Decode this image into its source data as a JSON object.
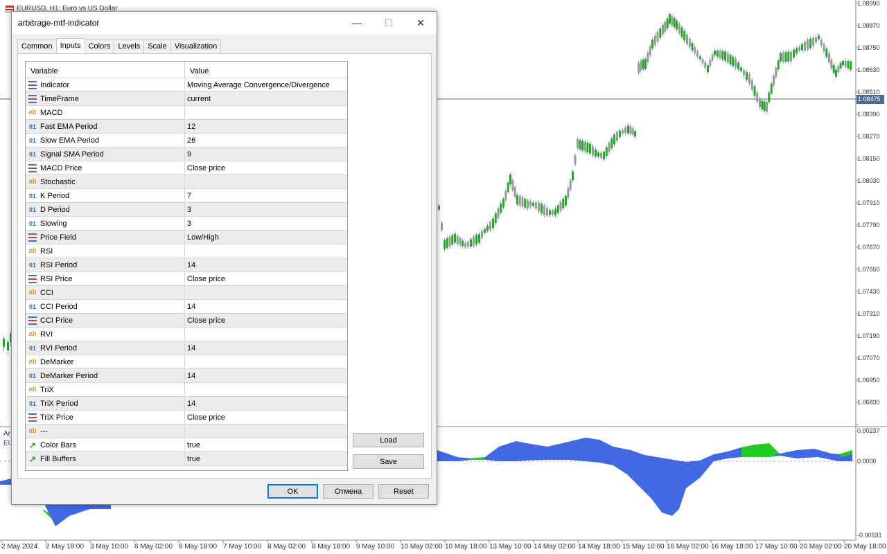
{
  "chart": {
    "title": "EURUSD, H1:  Euro vs US Dollar",
    "sub_labels": [
      "Ar",
      "EU"
    ],
    "current_price": "1.08475",
    "price_levels": [
      "1.08990",
      "1.08870",
      "1.08750",
      "1.08630",
      "1.08510",
      "1.08390",
      "1.08270",
      "1.08150",
      "1.08030",
      "1.07910",
      "1.07790",
      "1.07670",
      "1.07550",
      "1.07430",
      "1.07310",
      "1.07190",
      "1.07070",
      "1.06950",
      "1.06830"
    ],
    "sub_levels": [
      "0.00237",
      "0.0000",
      "-0.00531"
    ],
    "time_labels": [
      "2 May 2024",
      "2 May 18:00",
      "3 May 10:00",
      "6 May 02:00",
      "6 May 18:00",
      "7 May 10:00",
      "8 May 02:00",
      "8 May 18:00",
      "9 May 10:00",
      "10 May 02:00",
      "10 May 18:00",
      "13 May 10:00",
      "14 May 02:00",
      "14 May 18:00",
      "15 May 10:00",
      "16 May 02:00",
      "16 May 18:00",
      "17 May 10:00",
      "20 May 02:00",
      "20 May 18:00"
    ],
    "colors": {
      "bull": "#22aa22",
      "bear": "#999999",
      "fill_main": "#4169e1",
      "fill_alt": "#22cc22",
      "wick": "#2255cc"
    }
  },
  "dialog": {
    "title": "arbitrage-mtf-indicator",
    "minimize": "—",
    "maximize": "☐",
    "close": "✕",
    "tabs": [
      "Common",
      "Inputs",
      "Colors",
      "Levels",
      "Scale",
      "Visualization"
    ],
    "active_tab": 1,
    "columns": {
      "variable": "Variable",
      "value": "Value"
    },
    "rows": [
      {
        "type": "enum",
        "name": "Indicator",
        "value": "Moving Average Convergence/Divergence"
      },
      {
        "type": "enum",
        "name": "TimeFrame",
        "value": "current"
      },
      {
        "type": "str",
        "name": "MACD",
        "value": ""
      },
      {
        "type": "int",
        "name": "Fast EMA Period",
        "value": "12"
      },
      {
        "type": "int",
        "name": "Slow EMA Period",
        "value": "26"
      },
      {
        "type": "int",
        "name": "Signal SMA Period",
        "value": "9"
      },
      {
        "type": "enum",
        "name": "MACD Price",
        "value": "Close price"
      },
      {
        "type": "str",
        "name": "Stochastic",
        "value": ""
      },
      {
        "type": "int",
        "name": "K Period",
        "value": "7"
      },
      {
        "type": "int",
        "name": "D Period",
        "value": "3"
      },
      {
        "type": "int",
        "name": "Slowing",
        "value": "3"
      },
      {
        "type": "enum",
        "name": "Price Field",
        "value": "Low/High"
      },
      {
        "type": "str",
        "name": "RSI",
        "value": ""
      },
      {
        "type": "int",
        "name": "RSI Period",
        "value": "14"
      },
      {
        "type": "enum",
        "name": "RSI Price",
        "value": "Close price"
      },
      {
        "type": "str",
        "name": "CCI",
        "value": ""
      },
      {
        "type": "int",
        "name": "CCI Period",
        "value": "14"
      },
      {
        "type": "enum",
        "name": "CCI Price",
        "value": "Close price"
      },
      {
        "type": "str",
        "name": "RVI",
        "value": ""
      },
      {
        "type": "int",
        "name": "RVI Period",
        "value": "14"
      },
      {
        "type": "str",
        "name": "DeMarker",
        "value": ""
      },
      {
        "type": "int",
        "name": "DeMarker Period",
        "value": "14"
      },
      {
        "type": "str",
        "name": "TriX",
        "value": ""
      },
      {
        "type": "int",
        "name": "TriX Period",
        "value": "14"
      },
      {
        "type": "enum",
        "name": "TriX Price",
        "value": "Close price"
      },
      {
        "type": "str",
        "name": "---",
        "value": ""
      },
      {
        "type": "bool",
        "name": "Color Bars",
        "value": "true"
      },
      {
        "type": "bool",
        "name": "Fill Buffers",
        "value": "true"
      }
    ],
    "icon_text": {
      "str": "ab",
      "int": "01",
      "bool": "↗"
    },
    "load_label": "Load",
    "save_label": "Save",
    "ok_label": "OK",
    "cancel_label": "Отмена",
    "reset_label": "Reset"
  }
}
